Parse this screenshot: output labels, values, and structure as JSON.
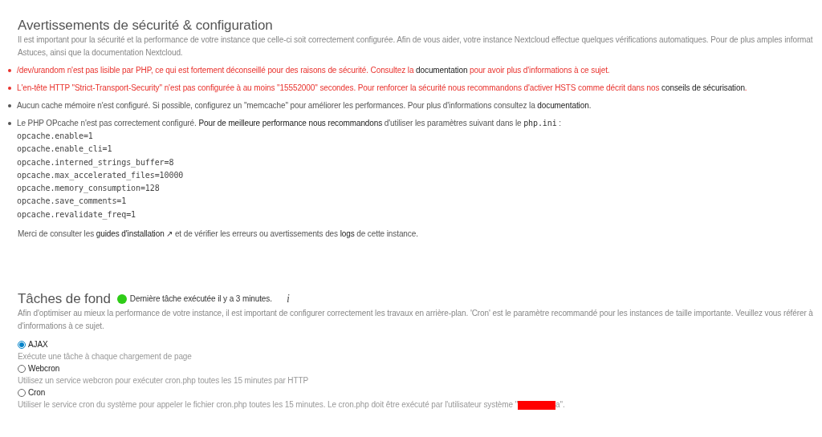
{
  "security": {
    "title": "Avertissements de sécurité & configuration",
    "intro": "Il est important pour la sécurité et la performance de votre instance que celle-ci soit correctement configurée. Afin de vous aider, votre instance Nextcloud effectue quelques vérifications automatiques. Pour de plus amples informat",
    "intro_line2": "Astuces, ainsi que la documentation Nextcloud.",
    "warnings": [
      {
        "kind": "error",
        "segments": [
          {
            "kind": "text",
            "text": "/dev/urandom n'est pas lisible par PHP, ce qui est fortement déconseillé pour des raisons de sécurité. Consultez la "
          },
          {
            "kind": "link",
            "text": "documentation"
          },
          {
            "kind": "text",
            "text": " pour avoir plus d'informations à ce sujet."
          }
        ]
      },
      {
        "kind": "error",
        "segments": [
          {
            "kind": "text",
            "text": "L'en-tête HTTP \"Strict-Transport-Security\" n'est pas configurée à au moins \"15552000\" secondes. Pour renforcer la sécurité nous recommandons d'activer HSTS comme décrit dans nos "
          },
          {
            "kind": "link",
            "text": "conseils de sécurisation"
          },
          {
            "kind": "text",
            "text": "."
          }
        ]
      },
      {
        "kind": "info",
        "segments": [
          {
            "kind": "text",
            "text": "Aucun cache mémoire n'est configuré. Si possible, configurez un \"memcache\" pour améliorer les performances. Pour plus d'informations consultez la "
          },
          {
            "kind": "link",
            "text": "documentation"
          },
          {
            "kind": "text",
            "text": "."
          }
        ]
      },
      {
        "kind": "info",
        "segments": [
          {
            "kind": "text",
            "text": "Le PHP OPcache n'est pas correctement configuré. "
          },
          {
            "kind": "link",
            "text": "Pour de meilleure performance nous recommandons"
          },
          {
            "kind": "text",
            "text": " d'utiliser les paramètres suivant dans le "
          },
          {
            "kind": "code",
            "text": "php.ini"
          },
          {
            "kind": "text",
            "text": " :"
          }
        ],
        "code_lines": [
          "opcache.enable=1",
          "opcache.enable_cli=1",
          "opcache.interned_strings_buffer=8",
          "opcache.max_accelerated_files=10000",
          "opcache.memory_consumption=128",
          "opcache.save_comments=1",
          "opcache.revalidate_freq=1"
        ]
      }
    ],
    "footer": [
      {
        "kind": "text",
        "text": "Merci de consulter les "
      },
      {
        "kind": "link",
        "text": "guides d'installation ↗"
      },
      {
        "kind": "text",
        "text": " et de vérifier les erreurs ou avertissements des "
      },
      {
        "kind": "link",
        "text": "logs"
      },
      {
        "kind": "text",
        "text": " de cette instance."
      }
    ]
  },
  "background_jobs": {
    "title": "Tâches de fond",
    "status": {
      "color": "#2ecc17",
      "text": "Dernière tâche exécutée il y a 3 minutes."
    },
    "info_icon": "i",
    "description": "Afin d'optimiser au mieux la performance de votre instance, il est important de configurer correctement les travaux en arrière-plan. 'Cron' est le paramètre recommandé pour les instances de taille importante. Veuillez vous référer à",
    "description_line2": "d'informations à ce sujet.",
    "options": [
      {
        "label": "AJAX",
        "selected": true,
        "hint": "Exécute une tâche à chaque chargement de page"
      },
      {
        "label": "Webcron",
        "selected": false,
        "hint": "Utilisez un service webcron pour exécuter cron.php toutes les 15 minutes par HTTP"
      },
      {
        "label": "Cron",
        "selected": false,
        "hint": "Utiliser le service cron du système pour appeler le fichier cron.php toutes les 15 minutes. Le cron.php doit être exécuté par l'utilisateur système \"",
        "hint_after": "a\"."
      }
    ]
  }
}
